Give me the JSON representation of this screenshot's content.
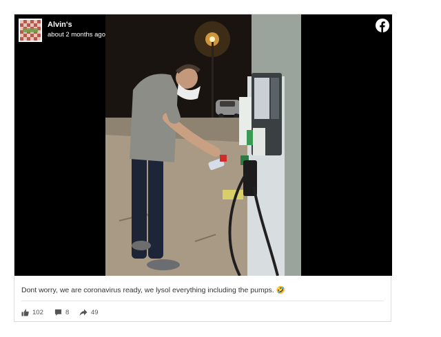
{
  "post": {
    "page_name": "Alvin's",
    "timestamp": "about 2 months ago",
    "caption": "Dont worry, we are coronavirus ready, we lysol everything including the pumps. 🤣",
    "brand_color": "#ffffff",
    "logo_icon": "facebook-icon"
  },
  "stats": {
    "likes": "102",
    "comments": "8",
    "shares": "49"
  },
  "icons": {
    "like": "thumbs-up-icon",
    "comment": "comment-icon",
    "share": "share-arrow-icon"
  }
}
